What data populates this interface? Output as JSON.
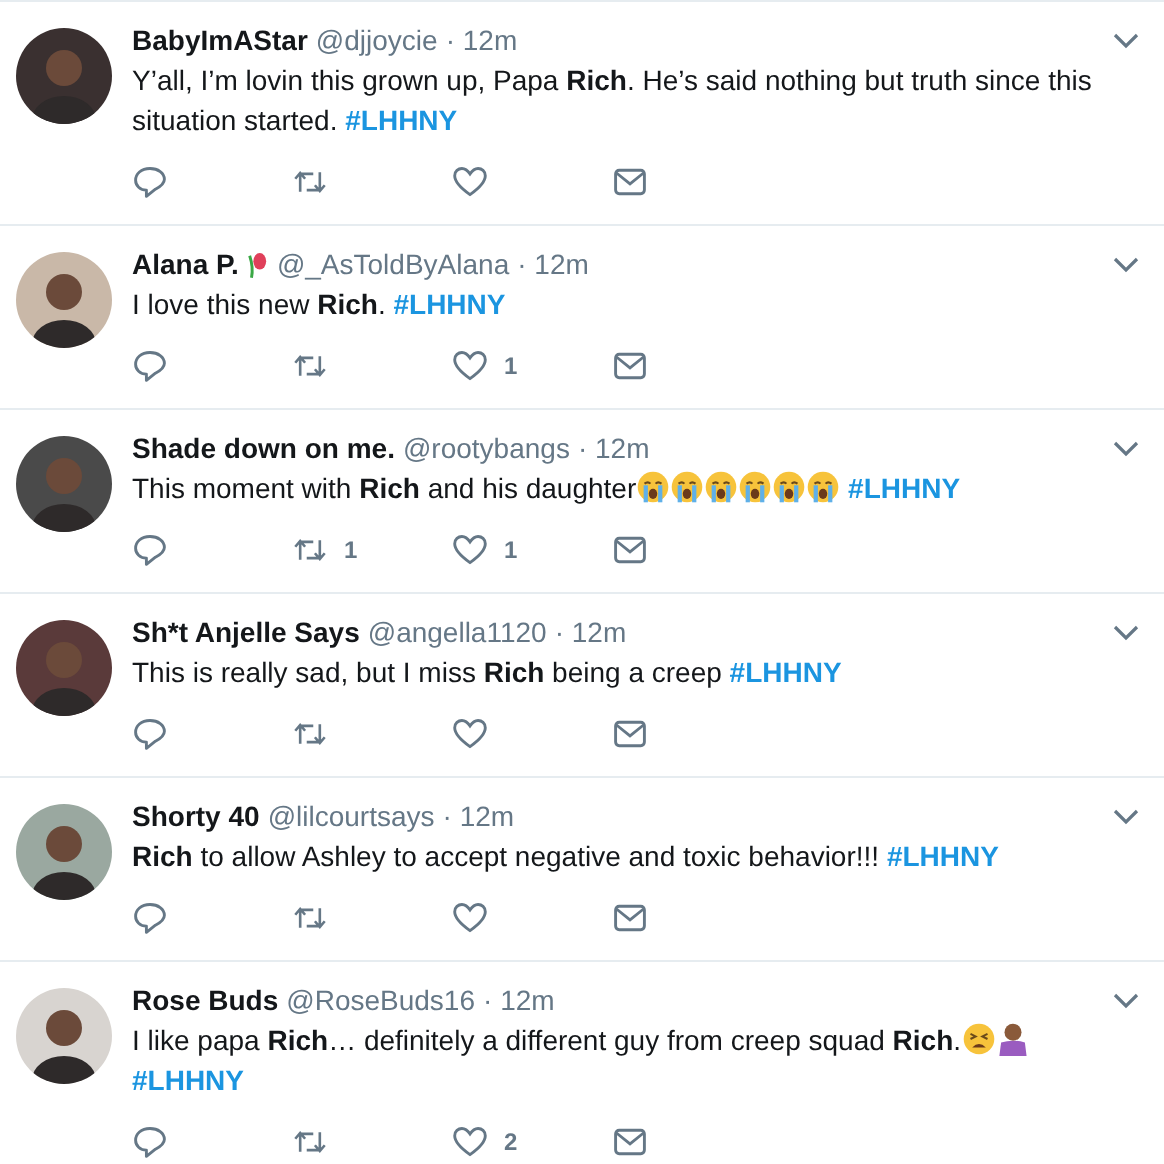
{
  "tweets": [
    {
      "name": "BabyImAStar",
      "handle": "@djjoycie",
      "time": "· 12m",
      "text": "Y’all, I’m lovin this grown up, Papa **Rich**. He’s said nothing but truth since this situation started.",
      "hashtag": "#LHHNY"
    },
    {
      "name": "Alana P.",
      "name_emoji": {
        "kind": "rose"
      },
      "handle": "@_AsToldByAlana",
      "time": "· 12m",
      "text": "I love this new **Rich**.",
      "hashtag": "#LHHNY",
      "likes": "1"
    },
    {
      "name": "Shade down on me.",
      "handle": "@rootybangs",
      "time": "· 12m",
      "text": "This moment with **Rich** and his daughter",
      "emojis": [
        {
          "kind": "crying"
        },
        {
          "kind": "crying"
        },
        {
          "kind": "crying"
        },
        {
          "kind": "crying"
        },
        {
          "kind": "crying"
        },
        {
          "kind": "crying"
        }
      ],
      "hashtag": "#LHHNY",
      "retweets": "1",
      "likes": "1"
    },
    {
      "name": "Sh*t Anjelle Says",
      "handle": "@angella1120",
      "time": "· 12m",
      "text": "This is really sad, but I miss **Rich** being a creep",
      "hashtag": "#LHHNY"
    },
    {
      "name": "Shorty 40",
      "handle": "@lilcourtsays",
      "time": "· 12m",
      "text": "**Rich** to allow Ashley to accept negative and toxic behavior!!!",
      "hashtag": "#LHHNY"
    },
    {
      "name": "Rose Buds",
      "handle": "@RoseBuds16",
      "time": "· 12m",
      "text": "I like papa **Rich**… definitely a different guy from creep squad **Rich**.",
      "emojis": [
        {
          "kind": "weary"
        },
        {
          "kind": "shrug"
        }
      ],
      "hashtag": "#LHHNY",
      "likes": "2"
    }
  ]
}
